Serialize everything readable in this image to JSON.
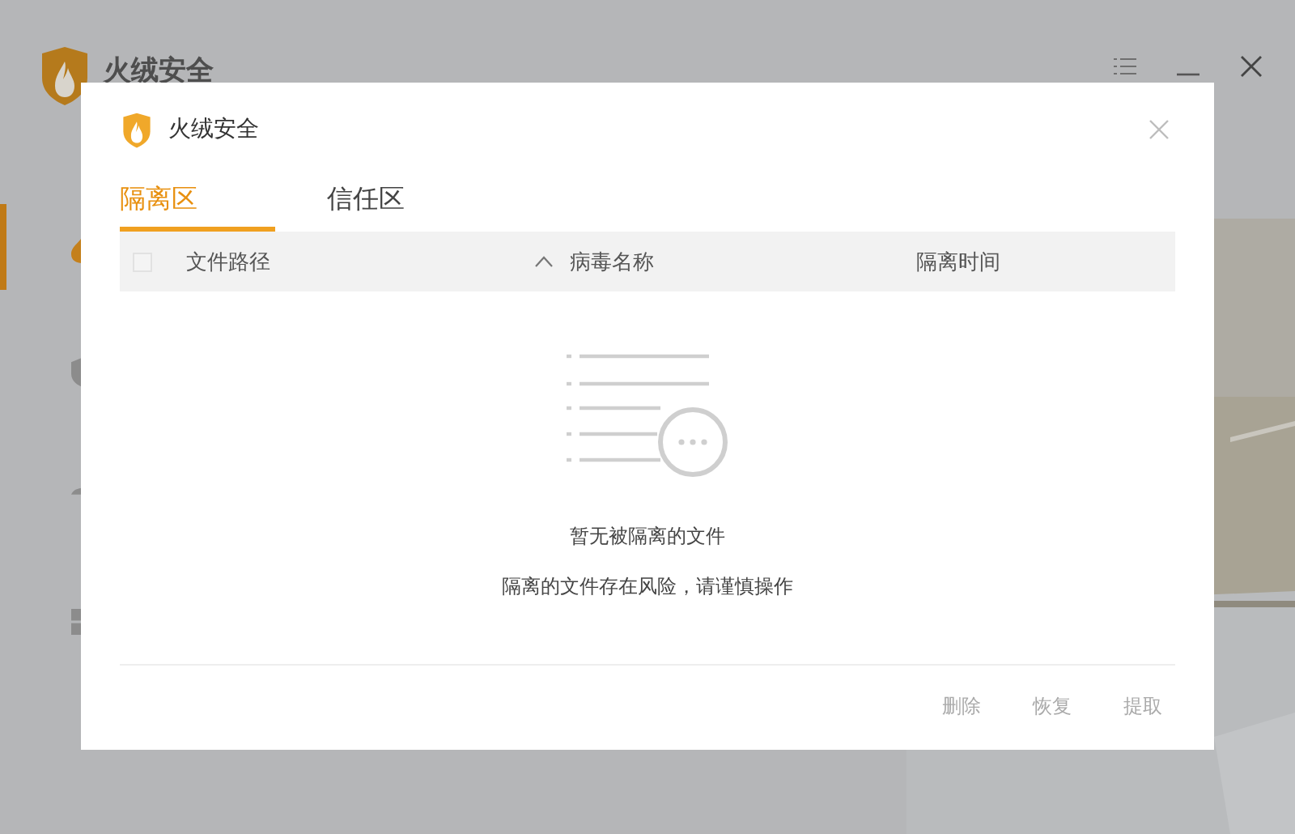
{
  "app": {
    "title": "火绒安全",
    "sidebar_items": [
      {
        "selected": true
      },
      {
        "selected": false
      },
      {
        "selected": false
      },
      {
        "selected": false
      }
    ]
  },
  "dialog": {
    "title": "火绒安全",
    "tabs": [
      {
        "label": "隔离区",
        "selected": true
      },
      {
        "label": "信任区",
        "selected": false
      }
    ],
    "select_all": {
      "checked": false
    },
    "columns": [
      {
        "label": "文件路径",
        "sort_ascending": true
      },
      {
        "label": "病毒名称"
      },
      {
        "label": "隔离时间"
      }
    ],
    "empty": {
      "title": "暂无被隔离的文件",
      "hint": "隔离的文件存在风险，请谨慎操作"
    },
    "buttons": [
      {
        "label": "删除",
        "disabled": true
      },
      {
        "label": "恢复",
        "disabled": true
      },
      {
        "label": "提取",
        "disabled": true
      }
    ]
  }
}
